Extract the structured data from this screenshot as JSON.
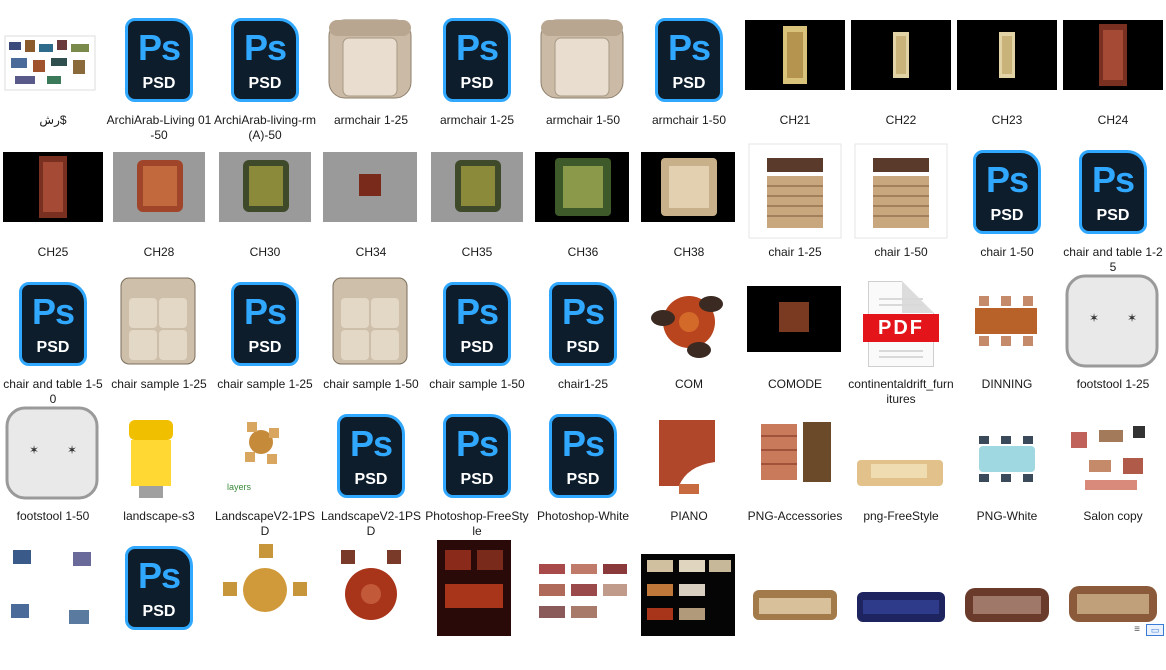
{
  "items": [
    {
      "label": "رش$",
      "kind": "img",
      "variant": "collage"
    },
    {
      "label": "ArchiArab-Living 01-50",
      "kind": "psd"
    },
    {
      "label": "ArchiArab-living-rm(A)-50",
      "kind": "psd"
    },
    {
      "label": "armchair 1-25",
      "kind": "img",
      "variant": "armchair"
    },
    {
      "label": "armchair 1-25",
      "kind": "psd"
    },
    {
      "label": "armchair 1-50",
      "kind": "img",
      "variant": "armchair"
    },
    {
      "label": "armchair 1-50",
      "kind": "psd"
    },
    {
      "label": "CH21",
      "kind": "img",
      "variant": "ch-black"
    },
    {
      "label": "CH22",
      "kind": "img",
      "variant": "ch-black-small"
    },
    {
      "label": "CH23",
      "kind": "img",
      "variant": "ch-black-small"
    },
    {
      "label": "CH24",
      "kind": "img",
      "variant": "ch-black-red"
    },
    {
      "label": "CH25",
      "kind": "img",
      "variant": "ch-black-red"
    },
    {
      "label": "CH28",
      "kind": "img",
      "variant": "grey-chair"
    },
    {
      "label": "CH30",
      "kind": "img",
      "variant": "grey-chair-green"
    },
    {
      "label": "CH34",
      "kind": "img",
      "variant": "grey-small"
    },
    {
      "label": "CH35",
      "kind": "img",
      "variant": "grey-chair-green"
    },
    {
      "label": "CH36",
      "kind": "img",
      "variant": "black-green"
    },
    {
      "label": "CH38",
      "kind": "img",
      "variant": "black-beige"
    },
    {
      "label": "chair 1-25",
      "kind": "img",
      "variant": "slat-chair"
    },
    {
      "label": "chair 1-50",
      "kind": "img",
      "variant": "slat-chair"
    },
    {
      "label": "chair 1-50",
      "kind": "psd"
    },
    {
      "label": "chair and table 1-25",
      "kind": "psd"
    },
    {
      "label": "chair and table 1-50",
      "kind": "psd"
    },
    {
      "label": "chair sample 1-25",
      "kind": "img",
      "variant": "sofa-top"
    },
    {
      "label": "chair sample 1-25",
      "kind": "psd"
    },
    {
      "label": "chair sample 1-50",
      "kind": "img",
      "variant": "sofa-top"
    },
    {
      "label": "chair sample 1-50",
      "kind": "psd"
    },
    {
      "label": "chair1-25",
      "kind": "psd"
    },
    {
      "label": "COM",
      "kind": "img",
      "variant": "com"
    },
    {
      "label": "COMODE",
      "kind": "img",
      "variant": "comode"
    },
    {
      "label": "continentaldrift_furnitures",
      "kind": "pdf"
    },
    {
      "label": "DINNING",
      "kind": "img",
      "variant": "dinning"
    },
    {
      "label": "footstool 1-25",
      "kind": "img",
      "variant": "footstool"
    },
    {
      "label": "footstool 1-50",
      "kind": "img",
      "variant": "footstool"
    },
    {
      "label": "landscape-s3",
      "kind": "img",
      "variant": "yellow-chair"
    },
    {
      "label": "LandscapeV2-1PSD",
      "kind": "img",
      "variant": "landscape-table"
    },
    {
      "label": "LandscapeV2-1PSD",
      "kind": "psd"
    },
    {
      "label": "Photoshop-FreeStyle",
      "kind": "psd"
    },
    {
      "label": "Photoshop-White",
      "kind": "psd"
    },
    {
      "label": "PIANO",
      "kind": "img",
      "variant": "piano"
    },
    {
      "label": "PNG-Accessories",
      "kind": "img",
      "variant": "accessories"
    },
    {
      "label": "png-FreeStyle",
      "kind": "img",
      "variant": "freestyle"
    },
    {
      "label": "PNG-White",
      "kind": "img",
      "variant": "png-white"
    },
    {
      "label": "Salon copy",
      "kind": "img",
      "variant": "salon"
    },
    {
      "label": "",
      "kind": "img",
      "variant": "row5-a"
    },
    {
      "label": "",
      "kind": "psd"
    },
    {
      "label": "",
      "kind": "img",
      "variant": "round-table"
    },
    {
      "label": "",
      "kind": "img",
      "variant": "round-table-red"
    },
    {
      "label": "",
      "kind": "img",
      "variant": "dark-red"
    },
    {
      "label": "",
      "kind": "img",
      "variant": "sofas"
    },
    {
      "label": "",
      "kind": "img",
      "variant": "sofas-dark"
    },
    {
      "label": "",
      "kind": "img",
      "variant": "sofa-wood"
    },
    {
      "label": "",
      "kind": "img",
      "variant": "sofa-blue"
    },
    {
      "label": "",
      "kind": "img",
      "variant": "sofa-classic"
    },
    {
      "label": "",
      "kind": "img",
      "variant": "sofa-classic2"
    }
  ],
  "psd_icon": {
    "title": "Ps",
    "subtitle": "PSD",
    "accent": "#31a8ff",
    "bg": "#0d1d2c"
  },
  "pdf_icon": {
    "text": "PDF",
    "accent": "#e3151a"
  },
  "view_controls": {
    "details": "≡",
    "large": "▭"
  }
}
